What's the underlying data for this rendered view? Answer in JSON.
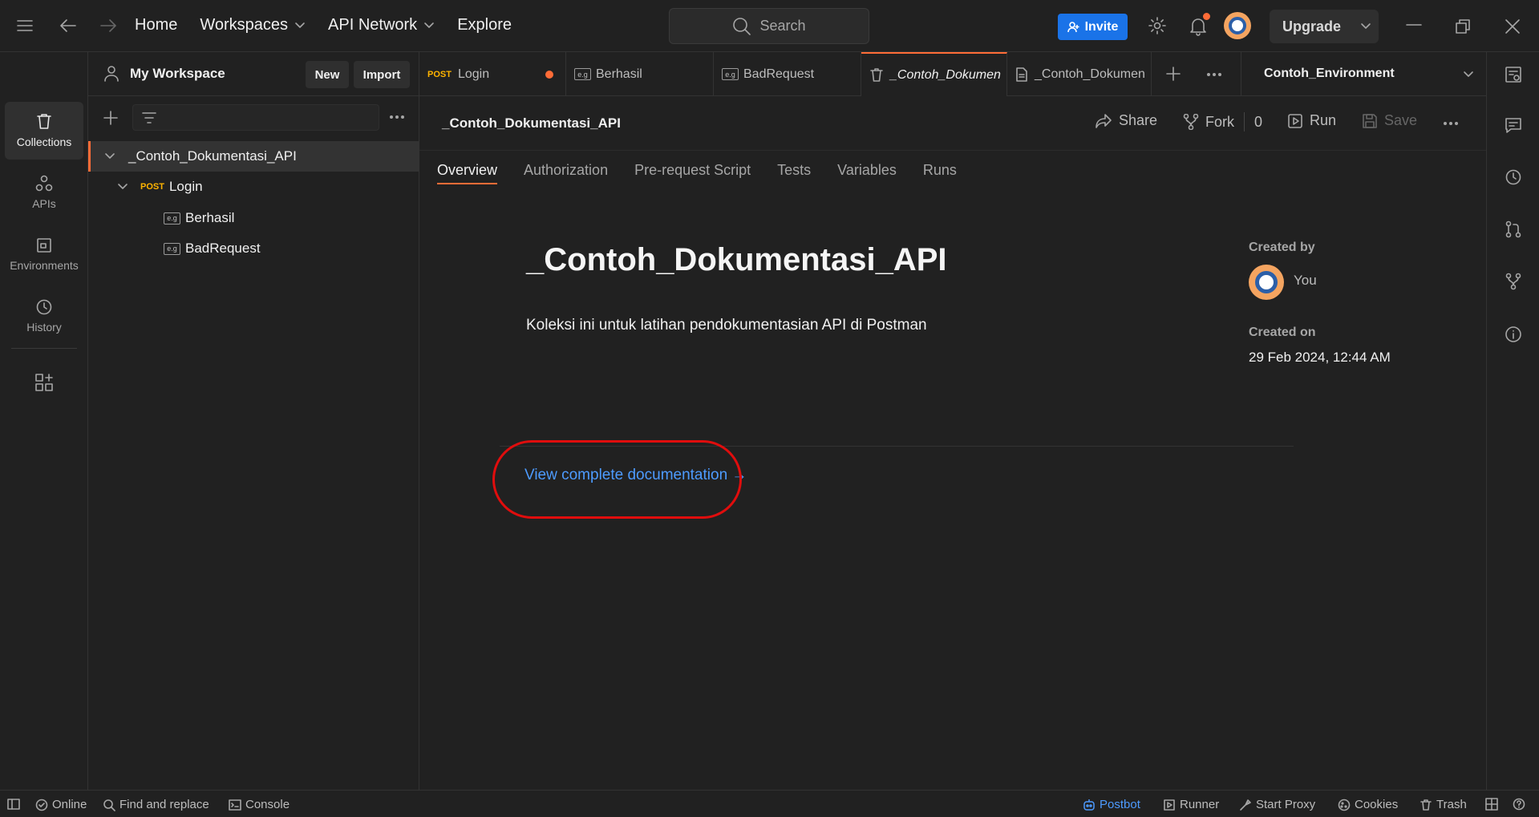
{
  "topbar": {
    "home": "Home",
    "workspaces": "Workspaces",
    "api_network": "API Network",
    "explore": "Explore",
    "search_placeholder": "Search",
    "invite": "Invite",
    "upgrade": "Upgrade"
  },
  "rail": {
    "collections": "Collections",
    "apis": "APIs",
    "environments": "Environments",
    "history": "History"
  },
  "sidebar": {
    "workspace_title": "My Workspace",
    "new_btn": "New",
    "import_btn": "Import",
    "tree": {
      "collection": "_Contoh_Dokumentasi_API",
      "request_method": "POST",
      "request_name": "Login",
      "examples": [
        "Berhasil",
        "BadRequest"
      ],
      "example_badge": "e.g"
    }
  },
  "tabs": [
    {
      "method": "POST",
      "label": "Login"
    },
    {
      "badge": "e.g",
      "label": "Berhasil"
    },
    {
      "badge": "e.g",
      "label": "BadRequest"
    },
    {
      "label": "_Contoh_Dokumen"
    },
    {
      "label": "_Contoh_Dokumen"
    }
  ],
  "environment": "Contoh_Environment",
  "main": {
    "collection_name": "_Contoh_Dokumentasi_API",
    "actions": {
      "share": "Share",
      "fork": "Fork",
      "fork_count": "0",
      "run": "Run",
      "save": "Save"
    },
    "subtabs": [
      "Overview",
      "Authorization",
      "Pre-request Script",
      "Tests",
      "Variables",
      "Runs"
    ],
    "doc_title": "_Contoh_Dokumentasi_API",
    "doc_description": "Koleksi ini untuk latihan pendokumentasian API di Postman",
    "doc_link": "View complete documentation →",
    "created_by_label": "Created by",
    "created_by": "You",
    "created_on_label": "Created on",
    "created_on": "29 Feb 2024, 12:44 AM"
  },
  "statusbar": {
    "online": "Online",
    "find_replace": "Find and replace",
    "console": "Console",
    "postbot": "Postbot",
    "runner": "Runner",
    "start_proxy": "Start Proxy",
    "cookies": "Cookies",
    "trash": "Trash"
  },
  "colors": {
    "accent": "#ff6c37",
    "invite_blue": "#1a73e8",
    "link_blue": "#4d9bff",
    "highlight_red": "#e00d0d",
    "post_yellow": "#ffb400"
  }
}
